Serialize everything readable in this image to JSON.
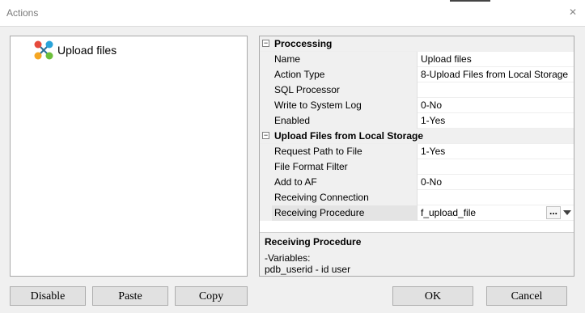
{
  "window": {
    "title": "Actions"
  },
  "tree": {
    "item_label": "Upload files",
    "item_icon": "app-cross-icon"
  },
  "grid": {
    "categories": [
      {
        "label": "Proccessing",
        "properties": [
          {
            "name": "Name",
            "value": "Upload files"
          },
          {
            "name": "Action Type",
            "value": "8-Upload Files from Local Storage"
          },
          {
            "name": "SQL Processor",
            "value": ""
          },
          {
            "name": "Write to System Log",
            "value": "0-No"
          },
          {
            "name": "Enabled",
            "value": "1-Yes"
          }
        ]
      },
      {
        "label": "Upload Files from Local Storage",
        "properties": [
          {
            "name": "Request Path to File",
            "value": "1-Yes"
          },
          {
            "name": "File Format Filter",
            "value": ""
          },
          {
            "name": "Add to AF",
            "value": "0-No"
          },
          {
            "name": "Receiving Connection",
            "value": ""
          },
          {
            "name": "Receiving Procedure",
            "value": "f_upload_file"
          }
        ]
      }
    ],
    "ellipsis_label": "..."
  },
  "help": {
    "title": "Receiving Procedure",
    "lines": [
      "-Variables:",
      "pdb_userid - id user"
    ]
  },
  "buttons": {
    "disable": "Disable",
    "paste": "Paste",
    "copy": "Copy",
    "ok": "OK",
    "cancel": "Cancel"
  }
}
